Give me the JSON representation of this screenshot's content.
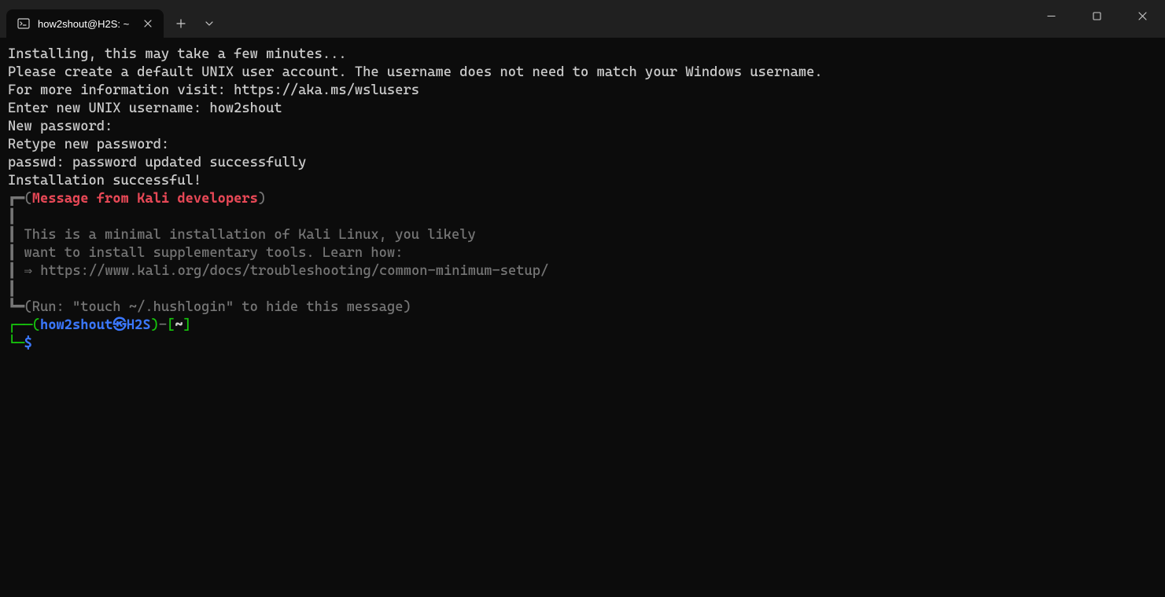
{
  "titlebar": {
    "tab_title": "how2shout@H2S: ~"
  },
  "terminal": {
    "line1": "Installing, this may take a few minutes...",
    "line2": "Please create a default UNIX user account. The username does not need to match your Windows username.",
    "line3": "For more information visit: https://aka.ms/wslusers",
    "line4_label": "Enter new UNIX username: ",
    "line4_value": "how2shout",
    "line5": "New password:",
    "line6": "Retype new password:",
    "line7": "passwd: password updated successfully",
    "line8": "Installation successful!",
    "box_top_left": "┏━(",
    "box_header": "Message from Kali developers",
    "box_top_right": ")",
    "box_pipe": "┃",
    "box_msg1": "┃ This is a minimal installation of Kali Linux, you likely",
    "box_msg2": "┃ want to install supplementary tools. Learn how:",
    "box_msg3": "┃ ⇒ https://www.kali.org/docs/troubleshooting/common-minimum-setup/",
    "box_bot_left": "┗━(",
    "box_footer": "Run: \"touch ~/.hushlogin\" to hide this message",
    "box_bot_right": ")",
    "prompt_corner_top": "┌──",
    "prompt_open": "(",
    "prompt_user": "how2shout",
    "prompt_sym": "㉿",
    "prompt_host": "H2S",
    "prompt_close": ")",
    "prompt_dash": "-",
    "prompt_bracket_open": "[",
    "prompt_path": "~",
    "prompt_bracket_close": "]",
    "prompt_corner_bot": "└─",
    "prompt_dollar": "$"
  }
}
